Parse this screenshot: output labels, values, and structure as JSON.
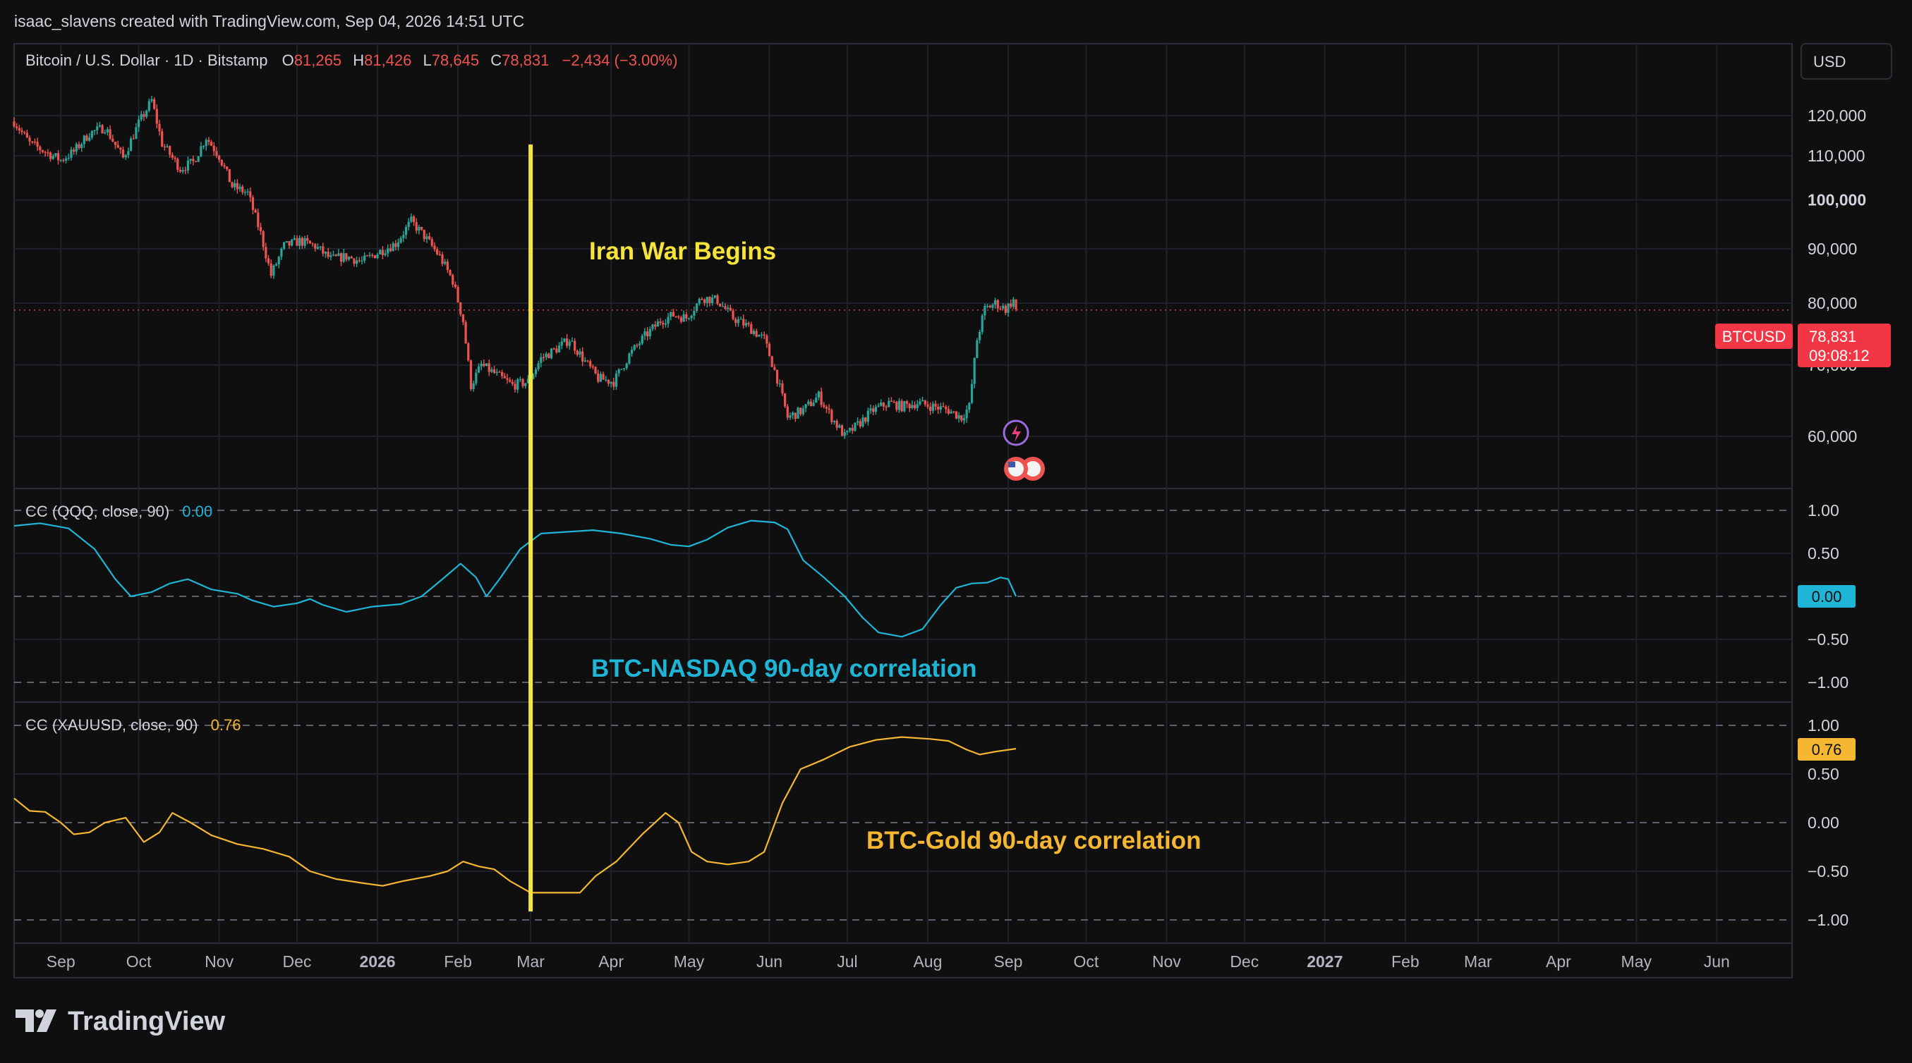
{
  "header": {
    "attribution": "isaac_slavens created with TradingView.com, Sep 04, 2026 14:51 UTC"
  },
  "legend": {
    "symbol": "Bitcoin / U.S. Dollar · 1D · Bitstamp",
    "o_label": "O",
    "o_value": "81,265",
    "h_label": "H",
    "h_value": "81,426",
    "l_label": "L",
    "l_value": "78,645",
    "c_label": "C",
    "c_value": "78,831",
    "change": "−2,434 (−3.00%)"
  },
  "currency_button": "USD",
  "price_tags": {
    "symbol": "BTCUSD",
    "last": "78,831",
    "countdown": "09:08:12"
  },
  "footer": {
    "brand": "TradingView"
  },
  "colors": {
    "background": "#0f0f0f",
    "up": "#26a69a",
    "down": "#ef5350",
    "qqq_line": "#1fb5d6",
    "gold_line": "#f5b731",
    "event_line": "#f7e43a"
  },
  "chart_data": [
    {
      "type": "candlestick",
      "title": "Bitcoin / U.S. Dollar · 1D · Bitstamp",
      "x_range": [
        "2025-08-14",
        "2027-06-30"
      ],
      "ylim": [
        50000,
        130000
      ],
      "scale": "log",
      "y_ticks": [
        "120,000",
        "110,000",
        "100,000",
        "90,000",
        "80,000",
        "70,000",
        "60,000"
      ],
      "x_ticks": [
        "Sep",
        "Oct",
        "Nov",
        "Dec",
        "2026",
        "Feb",
        "Mar",
        "Apr",
        "May",
        "Jun",
        "Jul",
        "Aug",
        "Sep",
        "Oct",
        "Nov",
        "Dec",
        "2027",
        "Feb",
        "Mar",
        "Apr",
        "May",
        "Jun"
      ],
      "close_path": [
        [
          "2025-08-14",
          118500
        ],
        [
          "2025-08-20",
          113000
        ],
        [
          "2025-08-26",
          111000
        ],
        [
          "2025-09-01",
          109000
        ],
        [
          "2025-09-06",
          111000
        ],
        [
          "2025-09-12",
          115500
        ],
        [
          "2025-09-18",
          117000
        ],
        [
          "2025-09-25",
          109500
        ],
        [
          "2025-10-01",
          118000
        ],
        [
          "2025-10-06",
          124000
        ],
        [
          "2025-10-10",
          113000
        ],
        [
          "2025-10-17",
          107000
        ],
        [
          "2025-10-22",
          108500
        ],
        [
          "2025-10-27",
          114500
        ],
        [
          "2025-11-01",
          110000
        ],
        [
          "2025-11-06",
          103000
        ],
        [
          "2025-11-12",
          101500
        ],
        [
          "2025-11-17",
          93000
        ],
        [
          "2025-11-21",
          85000
        ],
        [
          "2025-11-26",
          90500
        ],
        [
          "2025-12-02",
          91500
        ],
        [
          "2025-12-08",
          90500
        ],
        [
          "2025-12-14",
          88000
        ],
        [
          "2025-12-20",
          88500
        ],
        [
          "2025-12-26",
          87500
        ],
        [
          "2026-01-02",
          89500
        ],
        [
          "2026-01-08",
          91000
        ],
        [
          "2026-01-14",
          95500
        ],
        [
          "2026-01-19",
          92500
        ],
        [
          "2026-01-25",
          88500
        ],
        [
          "2026-01-30",
          84000
        ],
        [
          "2026-02-03",
          77000
        ],
        [
          "2026-02-06",
          67000
        ],
        [
          "2026-02-10",
          70000
        ],
        [
          "2026-02-16",
          68500
        ],
        [
          "2026-02-22",
          67000
        ],
        [
          "2026-02-28",
          67500
        ],
        [
          "2026-03-05",
          71000
        ],
        [
          "2026-03-11",
          72500
        ],
        [
          "2026-03-16",
          74000
        ],
        [
          "2026-03-22",
          70500
        ],
        [
          "2026-03-27",
          68000
        ],
        [
          "2026-04-02",
          67500
        ],
        [
          "2026-04-08",
          71500
        ],
        [
          "2026-04-14",
          74500
        ],
        [
          "2026-04-20",
          77000
        ],
        [
          "2026-04-25",
          78000
        ],
        [
          "2026-04-30",
          77500
        ],
        [
          "2026-05-06",
          81000
        ],
        [
          "2026-05-12",
          80500
        ],
        [
          "2026-05-18",
          77500
        ],
        [
          "2026-05-24",
          76000
        ],
        [
          "2026-05-30",
          74000
        ],
        [
          "2026-06-04",
          68000
        ],
        [
          "2026-06-08",
          62500
        ],
        [
          "2026-06-14",
          63500
        ],
        [
          "2026-06-20",
          65500
        ],
        [
          "2026-06-25",
          62500
        ],
        [
          "2026-06-30",
          60000
        ],
        [
          "2026-07-05",
          61500
        ],
        [
          "2026-07-11",
          63500
        ],
        [
          "2026-07-17",
          64500
        ],
        [
          "2026-07-22",
          64000
        ],
        [
          "2026-07-28",
          64500
        ],
        [
          "2026-08-03",
          64000
        ],
        [
          "2026-08-09",
          63500
        ],
        [
          "2026-08-14",
          62500
        ],
        [
          "2026-08-17",
          64000
        ],
        [
          "2026-08-20",
          74000
        ],
        [
          "2026-08-23",
          79000
        ],
        [
          "2026-08-27",
          80000
        ],
        [
          "2026-08-31",
          79000
        ],
        [
          "2026-09-03",
          80500
        ],
        [
          "2026-09-04",
          78831
        ]
      ],
      "volatility": 0.011,
      "annotations": [
        {
          "date": "2026-03-01",
          "text": "Iran War Begins"
        }
      ],
      "last": {
        "label": "BTCUSD",
        "value": 78831,
        "countdown": "09:08:12"
      }
    },
    {
      "type": "line",
      "title": "CC (QQQ, close, 90)",
      "series_value_label": "0.00",
      "ylim": [
        -1.0,
        1.0
      ],
      "y_ticks": [
        "1.00",
        "0.50",
        "0.00",
        "−0.50",
        "−1.00"
      ],
      "series": [
        {
          "name": "BTC-NASDAQ 90-day correlation",
          "points": [
            [
              "2025-08-14",
              0.82
            ],
            [
              "2025-08-24",
              0.85
            ],
            [
              "2025-09-04",
              0.79
            ],
            [
              "2025-09-14",
              0.55
            ],
            [
              "2025-09-22",
              0.2
            ],
            [
              "2025-09-28",
              0.0
            ],
            [
              "2025-10-06",
              0.05
            ],
            [
              "2025-10-13",
              0.15
            ],
            [
              "2025-10-20",
              0.2
            ],
            [
              "2025-10-29",
              0.08
            ],
            [
              "2025-11-08",
              0.03
            ],
            [
              "2025-11-14",
              -0.05
            ],
            [
              "2025-11-22",
              -0.12
            ],
            [
              "2025-12-01",
              -0.08
            ],
            [
              "2025-12-06",
              -0.03
            ],
            [
              "2025-12-11",
              -0.1
            ],
            [
              "2025-12-20",
              -0.18
            ],
            [
              "2025-12-30",
              -0.12
            ],
            [
              "2026-01-10",
              -0.09
            ],
            [
              "2026-01-18",
              0.0
            ],
            [
              "2026-01-26",
              0.2
            ],
            [
              "2026-02-02",
              0.38
            ],
            [
              "2026-02-08",
              0.22
            ],
            [
              "2026-02-12",
              0.0
            ],
            [
              "2026-02-17",
              0.2
            ],
            [
              "2026-02-25",
              0.55
            ],
            [
              "2026-03-05",
              0.73
            ],
            [
              "2026-03-15",
              0.75
            ],
            [
              "2026-03-25",
              0.77
            ],
            [
              "2026-04-05",
              0.73
            ],
            [
              "2026-04-16",
              0.67
            ],
            [
              "2026-04-24",
              0.6
            ],
            [
              "2026-05-01",
              0.58
            ],
            [
              "2026-05-08",
              0.66
            ],
            [
              "2026-05-16",
              0.8
            ],
            [
              "2026-05-25",
              0.88
            ],
            [
              "2026-06-03",
              0.86
            ],
            [
              "2026-06-08",
              0.78
            ],
            [
              "2026-06-14",
              0.42
            ],
            [
              "2026-06-22",
              0.22
            ],
            [
              "2026-06-30",
              0.0
            ],
            [
              "2026-07-07",
              -0.25
            ],
            [
              "2026-07-13",
              -0.42
            ],
            [
              "2026-07-22",
              -0.47
            ],
            [
              "2026-07-30",
              -0.38
            ],
            [
              "2026-08-06",
              -0.1
            ],
            [
              "2026-08-12",
              0.1
            ],
            [
              "2026-08-18",
              0.15
            ],
            [
              "2026-08-24",
              0.16
            ],
            [
              "2026-08-29",
              0.22
            ],
            [
              "2026-09-01",
              0.2
            ],
            [
              "2026-09-04",
              0.0
            ]
          ]
        }
      ],
      "annotations": [
        {
          "text": "BTC-NASDAQ 90-day correlation"
        }
      ]
    },
    {
      "type": "line",
      "title": "CC (XAUUSD, close, 90)",
      "series_value_label": "0.76",
      "ylim": [
        -1.0,
        1.0
      ],
      "y_ticks": [
        "1.00",
        "0.50",
        "0.00",
        "−0.50",
        "−1.00"
      ],
      "series": [
        {
          "name": "BTC-Gold 90-day correlation",
          "points": [
            [
              "2025-08-14",
              0.25
            ],
            [
              "2025-08-20",
              0.12
            ],
            [
              "2025-08-26",
              0.11
            ],
            [
              "2025-09-01",
              0.0
            ],
            [
              "2025-09-06",
              -0.12
            ],
            [
              "2025-09-12",
              -0.1
            ],
            [
              "2025-09-18",
              0.0
            ],
            [
              "2025-09-26",
              0.05
            ],
            [
              "2025-10-03",
              -0.2
            ],
            [
              "2025-10-09",
              -0.1
            ],
            [
              "2025-10-14",
              0.1
            ],
            [
              "2025-10-21",
              0.0
            ],
            [
              "2025-10-29",
              -0.13
            ],
            [
              "2025-11-08",
              -0.22
            ],
            [
              "2025-11-18",
              -0.27
            ],
            [
              "2025-11-28",
              -0.35
            ],
            [
              "2025-12-06",
              -0.5
            ],
            [
              "2025-12-16",
              -0.58
            ],
            [
              "2025-12-26",
              -0.62
            ],
            [
              "2026-01-03",
              -0.65
            ],
            [
              "2026-01-11",
              -0.6
            ],
            [
              "2026-01-21",
              -0.55
            ],
            [
              "2026-01-28",
              -0.5
            ],
            [
              "2026-02-03",
              -0.4
            ],
            [
              "2026-02-09",
              -0.45
            ],
            [
              "2026-02-15",
              -0.48
            ],
            [
              "2026-02-21",
              -0.6
            ],
            [
              "2026-03-01",
              -0.72
            ],
            [
              "2026-03-12",
              -0.72
            ],
            [
              "2026-03-20",
              -0.72
            ],
            [
              "2026-03-26",
              -0.55
            ],
            [
              "2026-04-03",
              -0.4
            ],
            [
              "2026-04-13",
              -0.12
            ],
            [
              "2026-04-22",
              0.1
            ],
            [
              "2026-04-27",
              0.0
            ],
            [
              "2026-05-02",
              -0.3
            ],
            [
              "2026-05-08",
              -0.4
            ],
            [
              "2026-05-16",
              -0.43
            ],
            [
              "2026-05-24",
              -0.4
            ],
            [
              "2026-05-30",
              -0.3
            ],
            [
              "2026-06-06",
              0.2
            ],
            [
              "2026-06-13",
              0.55
            ],
            [
              "2026-06-22",
              0.65
            ],
            [
              "2026-07-02",
              0.78
            ],
            [
              "2026-07-12",
              0.85
            ],
            [
              "2026-07-22",
              0.88
            ],
            [
              "2026-08-02",
              0.86
            ],
            [
              "2026-08-09",
              0.84
            ],
            [
              "2026-08-16",
              0.75
            ],
            [
              "2026-08-21",
              0.7
            ],
            [
              "2026-08-27",
              0.73
            ],
            [
              "2026-09-04",
              0.76
            ]
          ]
        }
      ],
      "annotations": [
        {
          "text": "BTC-Gold 90-day correlation"
        }
      ]
    }
  ]
}
